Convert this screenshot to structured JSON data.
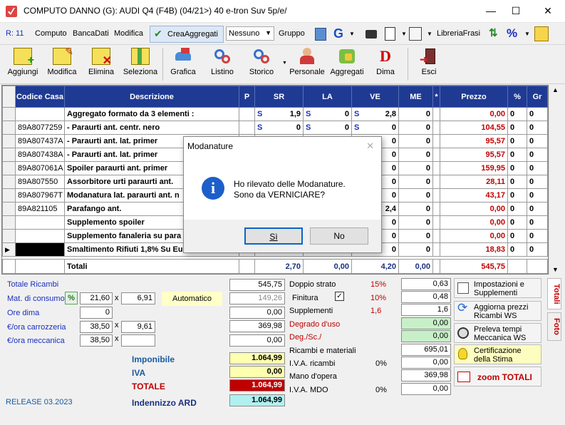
{
  "window": {
    "title": "COMPUTO DANNO (G):  AUDI Q4 (F4B)  (04/21>) 40 e-tron Suv 5p/e/",
    "minimize": "—",
    "maximize": "☐",
    "close": "✕"
  },
  "menu": {
    "r": "R: 11",
    "computo": "Computo",
    "bancadati": "BancaDati",
    "modifica": "Modifica",
    "creaaggregati": "CreaAggregati",
    "nessuno": "Nessuno",
    "gruppo": "Gruppo",
    "librerie": "LibreriaFrasi"
  },
  "toolbar": {
    "aggiungi": "Aggiungi",
    "modifica": "Modifica",
    "elimina": "Elimina",
    "seleziona": "Seleziona",
    "grafica": "Grafica",
    "listino": "Listino",
    "storico": "Storico",
    "personale": "Personale",
    "aggregati": "Aggregati",
    "dima": "Dima",
    "esci": "Esci"
  },
  "table": {
    "headers": {
      "codice": "Codice Casa",
      "descrizione": "Descrizione",
      "p": "P",
      "sr": "SR",
      "la": "LA",
      "ve": "VE",
      "me": "ME",
      "star": "*",
      "prezzo": "Prezzo",
      "pct": "%",
      "gr": "Gr"
    },
    "rows": [
      {
        "code": "",
        "desc": "Aggregato formato da 3 elementi :",
        "sr_s": "S",
        "sr": "1,9",
        "la_s": "S",
        "la": "0",
        "ve_s": "S",
        "ve": "2,8",
        "me": "0",
        "price": "0,00",
        "pct": "0",
        "gr": "0"
      },
      {
        "code": "89A8077259",
        "desc": "- Paraurti ant. centr. nero",
        "sr_s": "S",
        "sr": "0",
        "la_s": "S",
        "la": "0",
        "ve_s": "S",
        "ve": "0",
        "me": "0",
        "price": "104,55",
        "pct": "0",
        "gr": "0"
      },
      {
        "code": "89A807437A",
        "desc": "- Paraurti ant. lat. primer",
        "sr_s": "",
        "sr": "",
        "la_s": "",
        "la": "",
        "ve_s": "",
        "ve": "0",
        "me": "0",
        "price": "95,57",
        "pct": "0",
        "gr": "0"
      },
      {
        "code": "89A807438A",
        "desc": "- Paraurti ant. lat. primer",
        "sr_s": "",
        "sr": "",
        "la_s": "",
        "la": "",
        "ve_s": "",
        "ve": "0",
        "me": "0",
        "price": "95,57",
        "pct": "0",
        "gr": "0"
      },
      {
        "code": "89A807061A",
        "desc": "Spoiler paraurti ant. primer",
        "sr_s": "",
        "sr": "",
        "la_s": "",
        "la": "",
        "ve_s": "",
        "ve": "0",
        "me": "0",
        "price": "159,95",
        "pct": "0",
        "gr": "0"
      },
      {
        "code": "89A807550",
        "desc": "Assorbitore urti paraurti ant.",
        "sr_s": "",
        "sr": "",
        "la_s": "",
        "la": "",
        "ve_s": "",
        "ve": "0",
        "me": "0",
        "price": "28,11",
        "pct": "0",
        "gr": "0"
      },
      {
        "code": "89A807967T",
        "desc": "Modanatura lat. paraurti ant. n",
        "sr_s": "",
        "sr": "",
        "la_s": "",
        "la": "",
        "ve_s": "",
        "ve": "0",
        "me": "0",
        "price": "43,17",
        "pct": "0",
        "gr": "0"
      },
      {
        "code": "89A821105",
        "desc": "Parafango ant.",
        "sr_s": "",
        "sr": "",
        "la_s": "",
        "la": "",
        "ve_s": "",
        "ve": "2,4",
        "me": "0",
        "price": "0,00",
        "pct": "0",
        "gr": "0"
      },
      {
        "code": "",
        "desc": "Supplemento spoiler",
        "sr_s": "",
        "sr": "",
        "la_s": "",
        "la": "",
        "ve_s": "",
        "ve": "0",
        "me": "0",
        "price": "0,00",
        "pct": "0",
        "gr": "0"
      },
      {
        "code": "",
        "desc": "Supplemento fanaleria su para",
        "sr_s": "",
        "sr": "",
        "la_s": "",
        "la": "",
        "ve_s": "",
        "ve": "0",
        "me": "0",
        "price": "0,00",
        "pct": "0",
        "gr": "0"
      },
      {
        "code": "",
        "desc": "Smaltimento Rifiuti 1,8% Su Eu",
        "sr_s": "",
        "sr": "",
        "la_s": "",
        "la": "",
        "ve_s": "",
        "ve": "0",
        "me": "0",
        "price": "18,83",
        "pct": "0",
        "gr": "0"
      }
    ],
    "totals": {
      "label": "Totali",
      "sr": "2,70",
      "la": "0,00",
      "ve": "4,20",
      "me": "0,00",
      "price": "545,75"
    }
  },
  "left": {
    "totale_ricambi": "Totale Ricambi",
    "totale_ricambi_val": "545,75",
    "mat_consumo": "Mat. di consumo",
    "pct_btn": "%",
    "mat1": "21,60",
    "x": "x",
    "mat2": "6,91",
    "automatico": "Automatico",
    "mat_val": "149,26",
    "ore_dima": "Ore dima",
    "ore_dima_val": "0",
    "ore_dima_tot": "0,00",
    "ora_carr": "€/ora carrozzeria",
    "carr1": "38,50",
    "carr2": "9,61",
    "carr_tot": "369,98",
    "ora_mecc": "€/ora meccanica",
    "mecc1": "38,50",
    "mecc2": "",
    "mecc_tot": "0,00",
    "imponibile": "Imponibile",
    "imponibile_val": "1.064,99",
    "iva": "IVA",
    "iva_val": "0,00",
    "totale": "TOTALE",
    "totale_val": "1.064,99",
    "release": "RELEASE 03.2023",
    "indennizzo": "Indennizzo ARD",
    "indennizzo_val": "1.064,99"
  },
  "middle": {
    "doppio": "Doppio strato",
    "doppio_pct": "15%",
    "doppio_val": "0,63",
    "finitura": "Finitura",
    "finitura_check": "✓",
    "finitura_pct": "10%",
    "finitura_val": "0,48",
    "supplementi": "Supplementi",
    "supplementi_num": "1,6",
    "supplementi_val": "1,6",
    "degrado": "Degrado d'uso",
    "degrado_val": "0,00",
    "deg_sc": "Deg./Sc./",
    "deg_sc_val": "0,00",
    "ricambi_materiali": "Ricambi e materiali",
    "ricambi_materiali_val": "695,01",
    "iva_ricambi": "I.V.A. ricambi",
    "iva_ricambi_pct": "0%",
    "iva_ricambi_val": "0,00",
    "mano_opera": "Mano d'opera",
    "mano_opera_val": "369,98",
    "iva_mdo": "I.V.A. MDO",
    "iva_mdo_pct": "0%",
    "iva_mdo_val": "0,00"
  },
  "side": {
    "impostazioni": "Impostazioni e Supplementi",
    "aggiorna": "Aggiorna prezzi Ricambi WS",
    "preleva": "Preleva tempi Meccanica WS",
    "certificazione": "Certificazione della Stima",
    "zoom": "zoom TOTALI",
    "tab_totali": "Totali",
    "tab_foto": "Foto"
  },
  "dialog": {
    "title": "Modanature",
    "line1": "Ho rilevato delle Modanature.",
    "line2": "Sono da VERNICIARE?",
    "si": "Sì",
    "no": "No",
    "close": "✕"
  }
}
